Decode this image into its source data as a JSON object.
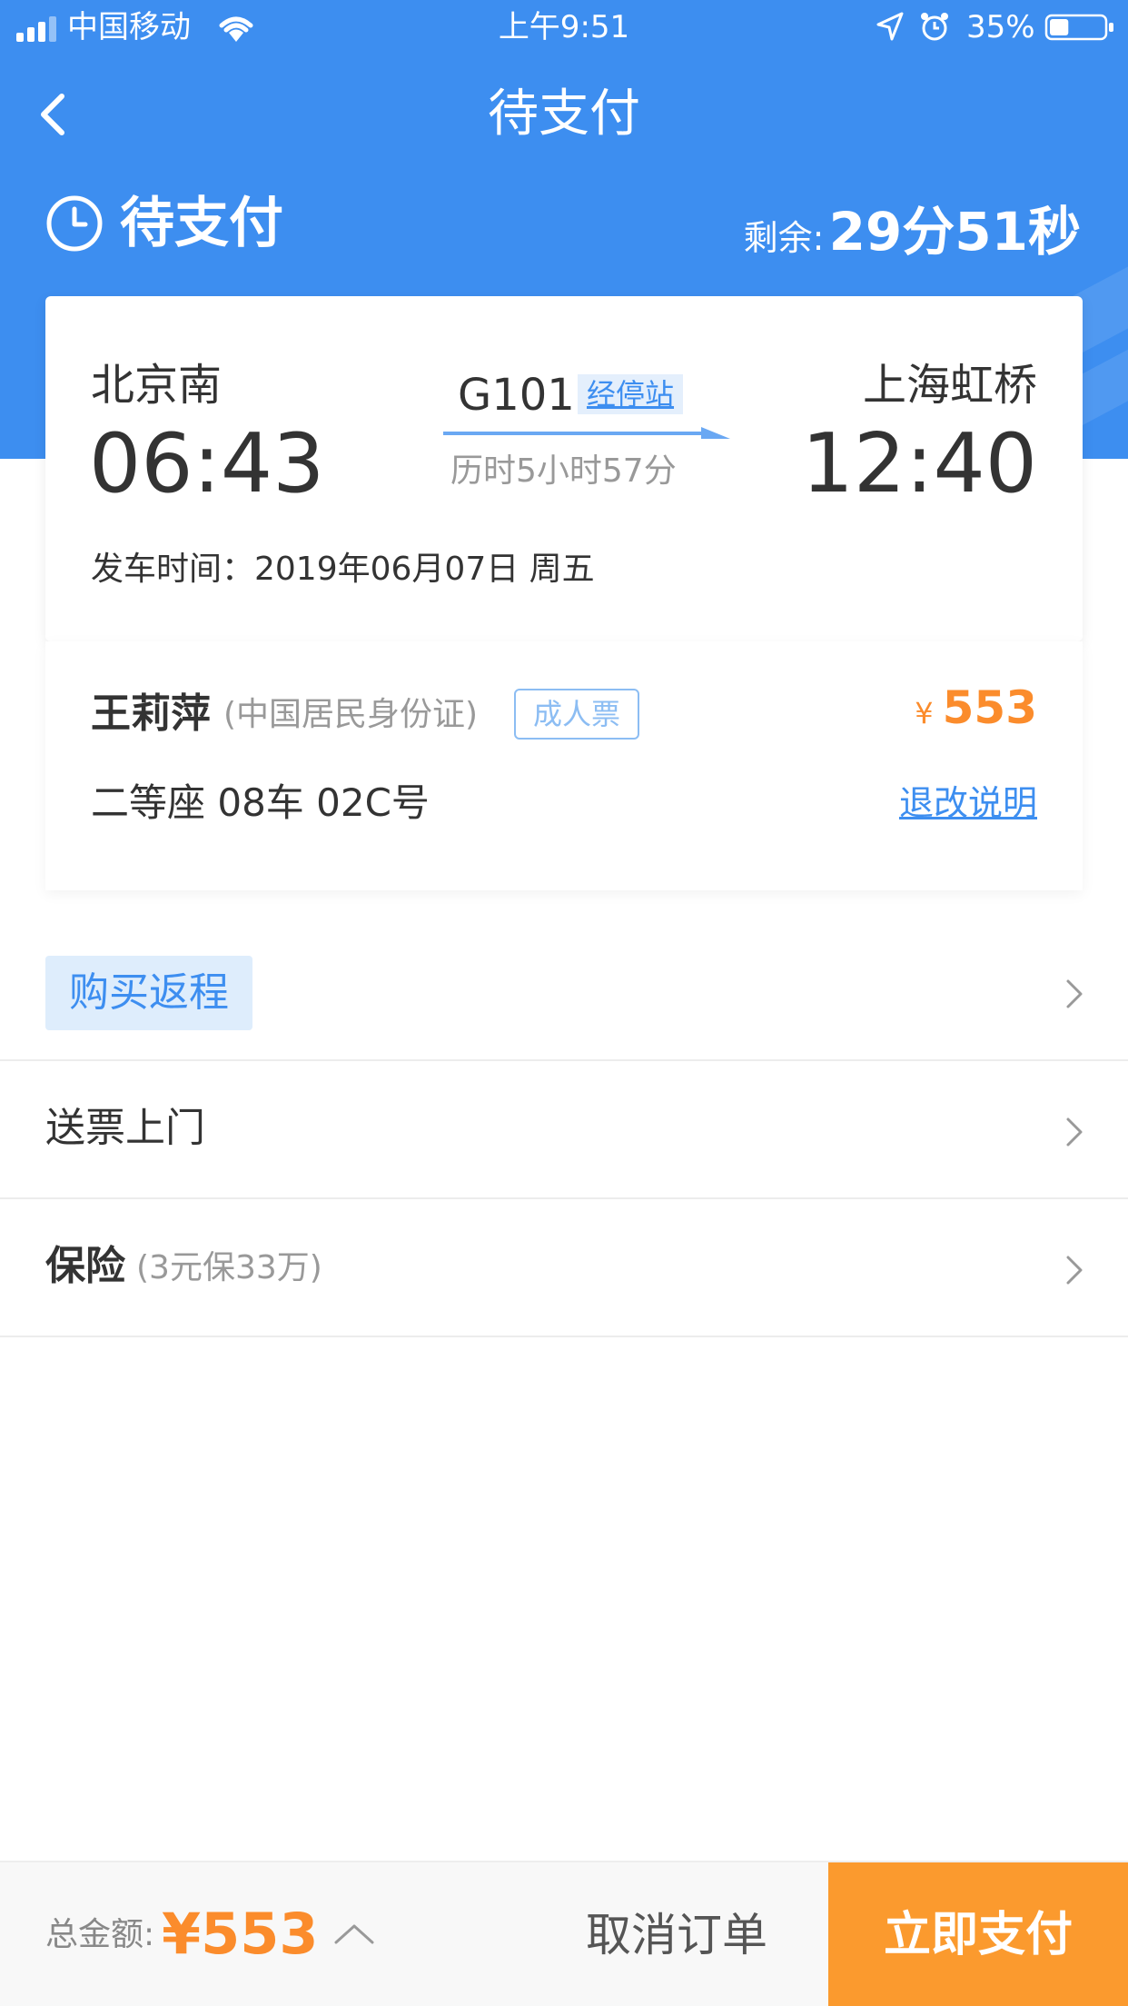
{
  "status_bar": {
    "carrier": "中国移动",
    "time": "上午9:51",
    "battery": "35%",
    "battery_level": 0.35,
    "icons": [
      "signal-icon",
      "wifi-icon",
      "location-arrow-icon",
      "alarm-icon",
      "battery-icon"
    ]
  },
  "nav": {
    "title": "待支付",
    "back_icon": "chevron-left-icon"
  },
  "order_status": {
    "icon": "clock-icon",
    "label": "待支付",
    "remaining_label": "剩余:",
    "remaining_value": "29分51秒"
  },
  "ticket": {
    "from_station": "北京南",
    "from_time": "06:43",
    "train_no": "G101",
    "stops_label": "经停站",
    "duration": "历时5小时57分",
    "to_station": "上海虹桥",
    "to_time": "12:40",
    "depart_date": "发车时间：2019年06月07日 周五"
  },
  "passenger": {
    "name": "王莉萍",
    "id_type": "(中国居民身份证)",
    "ticket_type": "成人票",
    "currency": "¥",
    "price": "553",
    "seat": "二等座  08车  02C号",
    "refund_label": "退改说明"
  },
  "options": {
    "return_trip": "购买返程",
    "delivery": "送票上门",
    "insurance": "保险",
    "insurance_sub": "(3元保33万)"
  },
  "footer": {
    "total_label": "总金额:",
    "total_amount": "¥553",
    "cancel_label": "取消订单",
    "pay_label": "立即支付"
  },
  "colors": {
    "primary_blue": "#3d8ef0",
    "accent_orange": "#fb8c2c",
    "pay_button": "#fb9a2e"
  }
}
